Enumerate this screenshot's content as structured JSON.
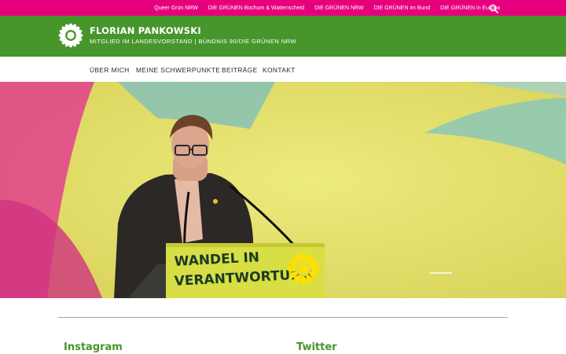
{
  "topbar": {
    "links": [
      "Queer Grün NRW",
      "DIE GRÜNEN Bochum & Wattenscheid",
      "DIE GRÜNEN NRW",
      "DIE GRÜNEN im Bund",
      "DIE GRÜNEN in Europa"
    ],
    "search_icon": "search-icon"
  },
  "header": {
    "title": "FLORIAN PANKOWSKI",
    "subtitle": "MITGLIED IM LANDESVORSTAND | BÜNDNIS 90/DIE GRÜNEN NRW",
    "logo_icon": "sunflower-icon"
  },
  "nav": {
    "items": [
      "ÜBER MICH",
      "MEINE SCHWERPUNKTE",
      "BEITRÄGE",
      "KONTAKT"
    ]
  },
  "hero": {
    "lectern_line1": "WANDEL IN",
    "lectern_line2": "VERANTWORTUNG."
  },
  "widgets": {
    "instagram_title": "Instagram",
    "twitter_title": "Twitter"
  },
  "colors": {
    "magenta": "#e6007e",
    "green": "#46962b",
    "yellow": "#e6e06a",
    "sunflower": "#ffe000"
  }
}
